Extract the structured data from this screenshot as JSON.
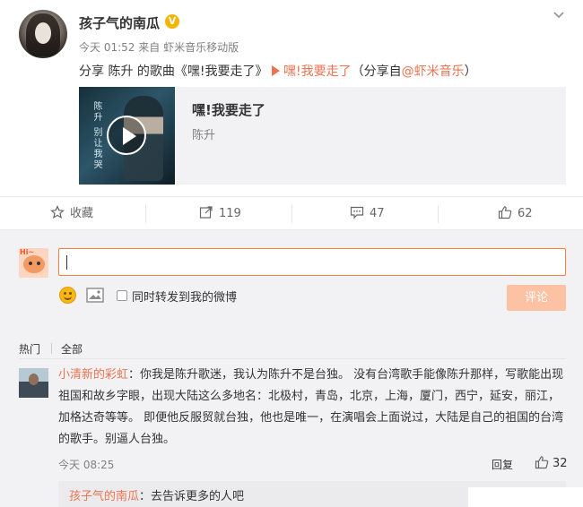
{
  "post": {
    "username": "孩子气的南瓜",
    "verified_badge": "V",
    "meta_time": "今天 01:52",
    "meta_from": "来自",
    "meta_source": "虾米音乐移动版",
    "share_prefix": "分享  陈升  的歌曲《嘿!我要走了》",
    "share_link": "嘿!我要走了",
    "share_suffix_open": "（分享自",
    "share_at": "@虾米音乐",
    "share_suffix_close": "）",
    "card": {
      "title": "嘿!我要走了",
      "artist": "陈升",
      "cover_text": "陈升 别让我哭"
    }
  },
  "actions": {
    "favorite_label": "收藏",
    "repost_count": "119",
    "comment_count": "47",
    "like_count": "62"
  },
  "composer": {
    "forward_label": "同时转发到我的微博",
    "submit_label": "评论",
    "avatar_text": "Hi~"
  },
  "filter": {
    "hot_label": "热门",
    "all_label": "全部"
  },
  "comment": {
    "nick": "小清新的彩虹",
    "text": "：你我是陈升歌迷，我认为陈升不是台独。 没有台湾歌手能像陈升那样，写歌能出现祖国和故乡字眼，出现大陆这么多地名：北极村，青岛，北京，上海，厦门，西宁，延安，丽江，加格达奇等等。 即便他反服贸就台独，他也是唯一，在演唱会上面说过，大陆是自己的祖国的台湾的歌手。别逼人台独。",
    "time": "今天 08:25",
    "reply_label": "回复",
    "like_count": "32",
    "sub_reply": {
      "nick": "孩子气的南瓜",
      "text": "：去告诉更多的人吧"
    }
  },
  "colors": {
    "accent": "#eb7350",
    "input_border": "#fa7d3c",
    "submit_bg": "#fcc2a3",
    "bg_gray": "#f2f2f5"
  }
}
